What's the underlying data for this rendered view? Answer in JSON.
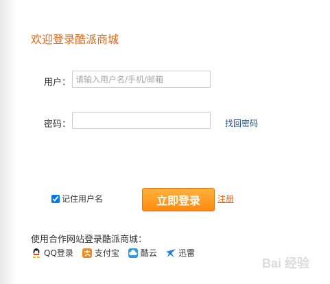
{
  "page": {
    "title": "欢迎登录酷派商城"
  },
  "form": {
    "username_label": "用户：",
    "username_placeholder": "请输入用户名/手机/邮箱",
    "username_value": "",
    "password_label": "密码：",
    "password_value": "",
    "forgot_password": "找回密码",
    "remember_label": "记住用户名",
    "remember_checked": true,
    "login_button": "立即登录",
    "register_link": "注册"
  },
  "partners": {
    "title": "使用合作网站登录酷派商城：",
    "items": [
      {
        "label": "QQ登录",
        "icon": "qq-icon"
      },
      {
        "label": "支付宝",
        "icon": "alipay-icon"
      },
      {
        "label": "酷云",
        "icon": "cloud-icon"
      },
      {
        "label": "迅雷",
        "icon": "thunder-icon"
      }
    ]
  },
  "watermark": {
    "text": "Bai 经验"
  },
  "colors": {
    "accent": "#e06a1b",
    "button": "#ff9a1f",
    "link": "#1a4f86"
  }
}
